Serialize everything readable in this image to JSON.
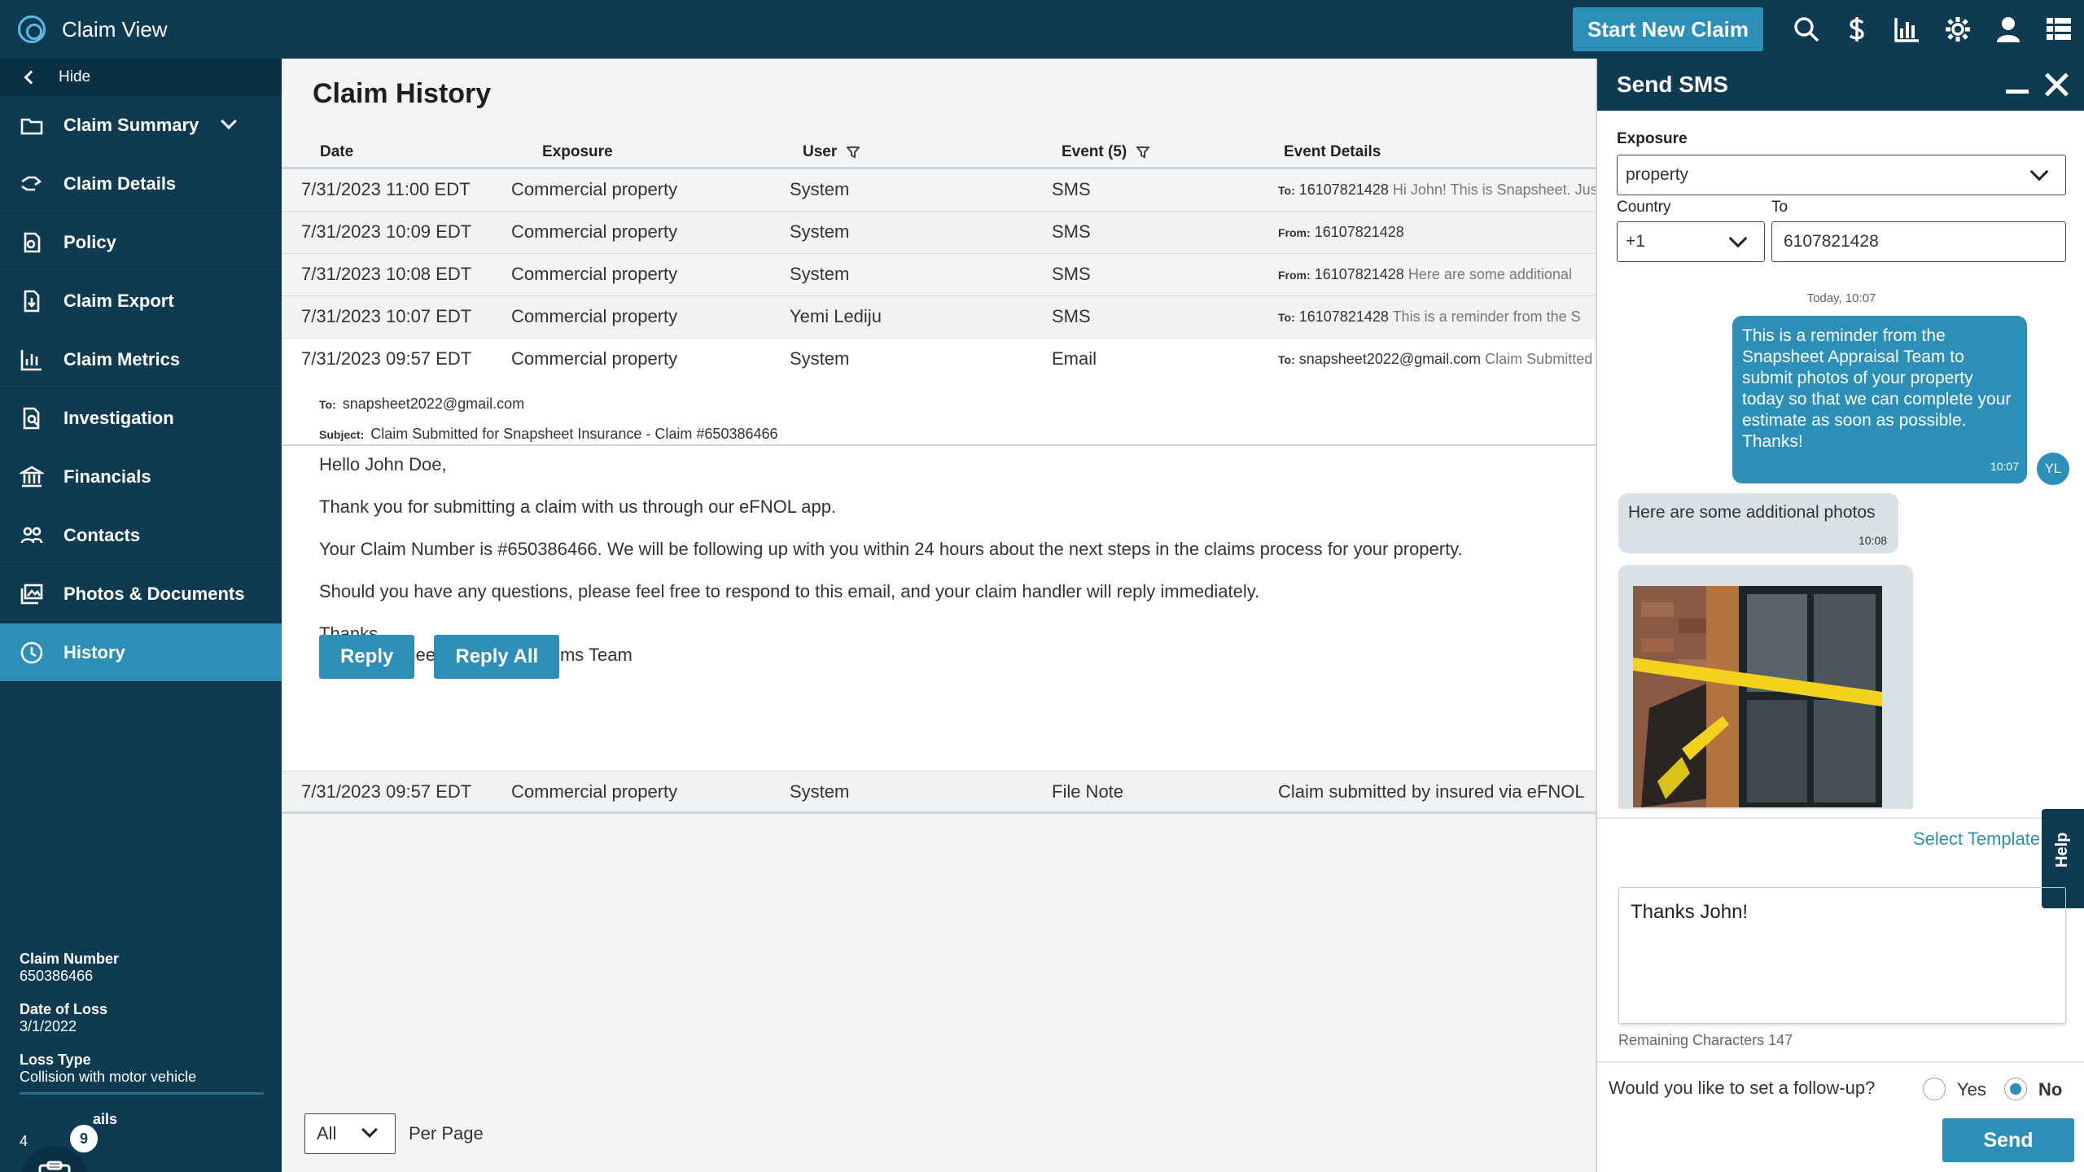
{
  "app": {
    "title": "Claim View",
    "new_claim_label": "Start New Claim"
  },
  "topbar_icons": [
    "search-icon",
    "dollar-icon",
    "bar-chart-icon",
    "gear-icon",
    "user-icon",
    "grid-menu-icon"
  ],
  "sidebar": {
    "hide_label": "Hide",
    "items": [
      {
        "label": "Claim Summary",
        "icon": "folder-icon"
      },
      {
        "label": "Claim Details",
        "icon": "hand-icon"
      },
      {
        "label": "Policy",
        "icon": "policy-icon"
      },
      {
        "label": "Claim Export",
        "icon": "export-icon"
      },
      {
        "label": "Claim Metrics",
        "icon": "metrics-icon"
      },
      {
        "label": "Investigation",
        "icon": "investigation-icon"
      },
      {
        "label": "Financials",
        "icon": "bank-icon"
      },
      {
        "label": "Contacts",
        "icon": "contacts-icon"
      },
      {
        "label": "Photos & Documents",
        "icon": "photos-icon"
      },
      {
        "label": "History",
        "icon": "clock-icon"
      }
    ],
    "claim_info": {
      "claim_number_label": "Claim Number",
      "claim_number": "650386466",
      "date_of_loss_label": "Date of Loss",
      "date_of_loss": "3/1/2022",
      "loss_type_label": "Loss Type",
      "loss_type": "Collision with motor vehicle",
      "partial_label": "ails",
      "partial_value": "4"
    },
    "tasks_count": "9"
  },
  "main": {
    "title": "Claim History",
    "columns": {
      "date": "Date",
      "exposure": "Exposure",
      "user": "User",
      "event": "Event (5)",
      "details": "Event Details"
    },
    "rows": [
      {
        "date": "7/31/2023 11:00 EDT",
        "exposure": "Commercial property",
        "user": "System",
        "event": "SMS",
        "detail_prefix": "To:",
        "detail_to": "16107821428",
        "detail_text": "Hi John! This is Snapsheet. Just"
      },
      {
        "date": "7/31/2023 10:09 EDT",
        "exposure": "Commercial property",
        "user": "System",
        "event": "SMS",
        "detail_prefix": "From:",
        "detail_to": "16107821428",
        "detail_text": ""
      },
      {
        "date": "7/31/2023 10:08 EDT",
        "exposure": "Commercial property",
        "user": "System",
        "event": "SMS",
        "detail_prefix": "From:",
        "detail_to": "16107821428",
        "detail_text": "Here are some additional"
      },
      {
        "date": "7/31/2023 10:07 EDT",
        "exposure": "Commercial property",
        "user": "Yemi Lediju",
        "event": "SMS",
        "detail_prefix": "To:",
        "detail_to": "16107821428",
        "detail_text": "This is a reminder from the S"
      },
      {
        "date": "7/31/2023 09:57 EDT",
        "exposure": "Commercial property",
        "user": "System",
        "event": "Email",
        "detail_prefix": "To:",
        "detail_to": "snapsheet2022@gmail.com",
        "detail_text": "Claim Submitted"
      }
    ],
    "email": {
      "to_label": "To:",
      "to": "snapsheet2022@gmail.com",
      "subject_label": "Subject:",
      "subject": "Claim Submitted for Snapsheet Insurance - Claim #650386466",
      "greeting": "Hello John Doe,",
      "p1": "Thank you for submitting a claim with us through our eFNOL app.",
      "p2": "Your Claim Number is #650386466. We will be following up with you within 24 hours about the next steps in the claims process for your property.",
      "p3": "Should you have any questions, please feel free to respond to this email, and your claim handler will reply immediately.",
      "sign1": "Thanks,",
      "sign2": "The Snapsheet Insurance Claims Team",
      "reply_label": "Reply",
      "reply_all_label": "Reply All"
    },
    "last_row": {
      "date": "7/31/2023 09:57 EDT",
      "exposure": "Commercial property",
      "user": "System",
      "event": "File Note",
      "detail_text": "Claim submitted by insured via eFNOL"
    },
    "pager": {
      "value": "All",
      "per_page_label": "Per Page"
    }
  },
  "sms": {
    "title": "Send SMS",
    "exposure_label": "Exposure",
    "exposure_value": "property",
    "country_label": "Country",
    "country_value": "+1",
    "to_label": "To",
    "to_value": "6107821428",
    "day_stamp": "Today, 10:07",
    "outgoing": {
      "text": "This is a reminder from the Snapsheet Appraisal Team to submit photos of your property today so that we can complete your estimate as soon as possible. Thanks!",
      "time": "10:07",
      "avatar": "YL"
    },
    "incoming": {
      "text": "Here are some additional photos",
      "time": "10:08"
    },
    "select_template": "Select Template",
    "help": "Help",
    "message": "Thanks John!",
    "remaining": "Remaining Characters 147",
    "followup_question": "Would you like to set a follow-up?",
    "yes_label": "Yes",
    "no_label": "No",
    "send_label": "Send"
  },
  "colors": {
    "navy": "#0f3b52",
    "accent": "#2b8fb8"
  }
}
